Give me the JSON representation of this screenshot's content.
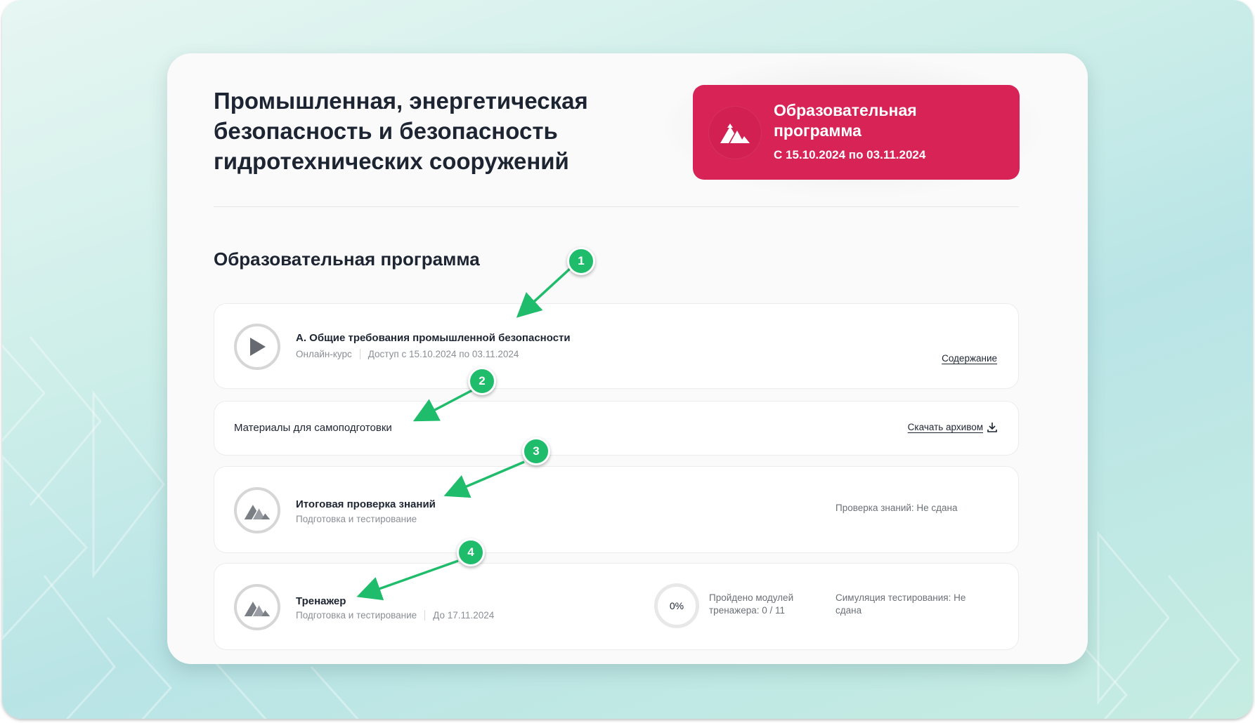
{
  "header": {
    "title": "Промышленная, энергетическая безопасность и безопасность гидротехнических сооружений"
  },
  "hero": {
    "title": "Образовательная программа",
    "dates": "С 15.10.2024 по 03.11.2024",
    "logo_icon": "mountain-logo-icon",
    "color": "#d82357"
  },
  "section": {
    "title": "Образовательная программа"
  },
  "items": [
    {
      "title": "А. Общие требования промышленной безопасности",
      "type": "Онлайн-курс",
      "access": "Доступ с 15.10.2024 по 03.11.2024",
      "link": "Содержание",
      "icon": "play-icon"
    },
    {
      "title": "Материалы для самоподготовки",
      "link": "Скачать архивом",
      "link_icon": "download-icon"
    },
    {
      "title": "Итоговая проверка знаний",
      "subtitle": "Подготовка и тестирование",
      "status": "Проверка знаний: Не сдана",
      "icon": "mountain-logo-icon"
    },
    {
      "title": "Тренажер",
      "subtitle": "Подготовка и тестирование",
      "deadline": "До 17.11.2024",
      "progress_percent": "0%",
      "progress_label": "Пройдено модулей тренажера: 0 / 11",
      "status": "Симуляция тестирования: Не сдана",
      "icon": "mountain-logo-icon"
    }
  ],
  "annotations": [
    "1",
    "2",
    "3",
    "4"
  ],
  "colors": {
    "accent": "#d82357",
    "annotation": "#1fbc6b",
    "text": "#1d2432",
    "muted": "#8a8f96"
  }
}
